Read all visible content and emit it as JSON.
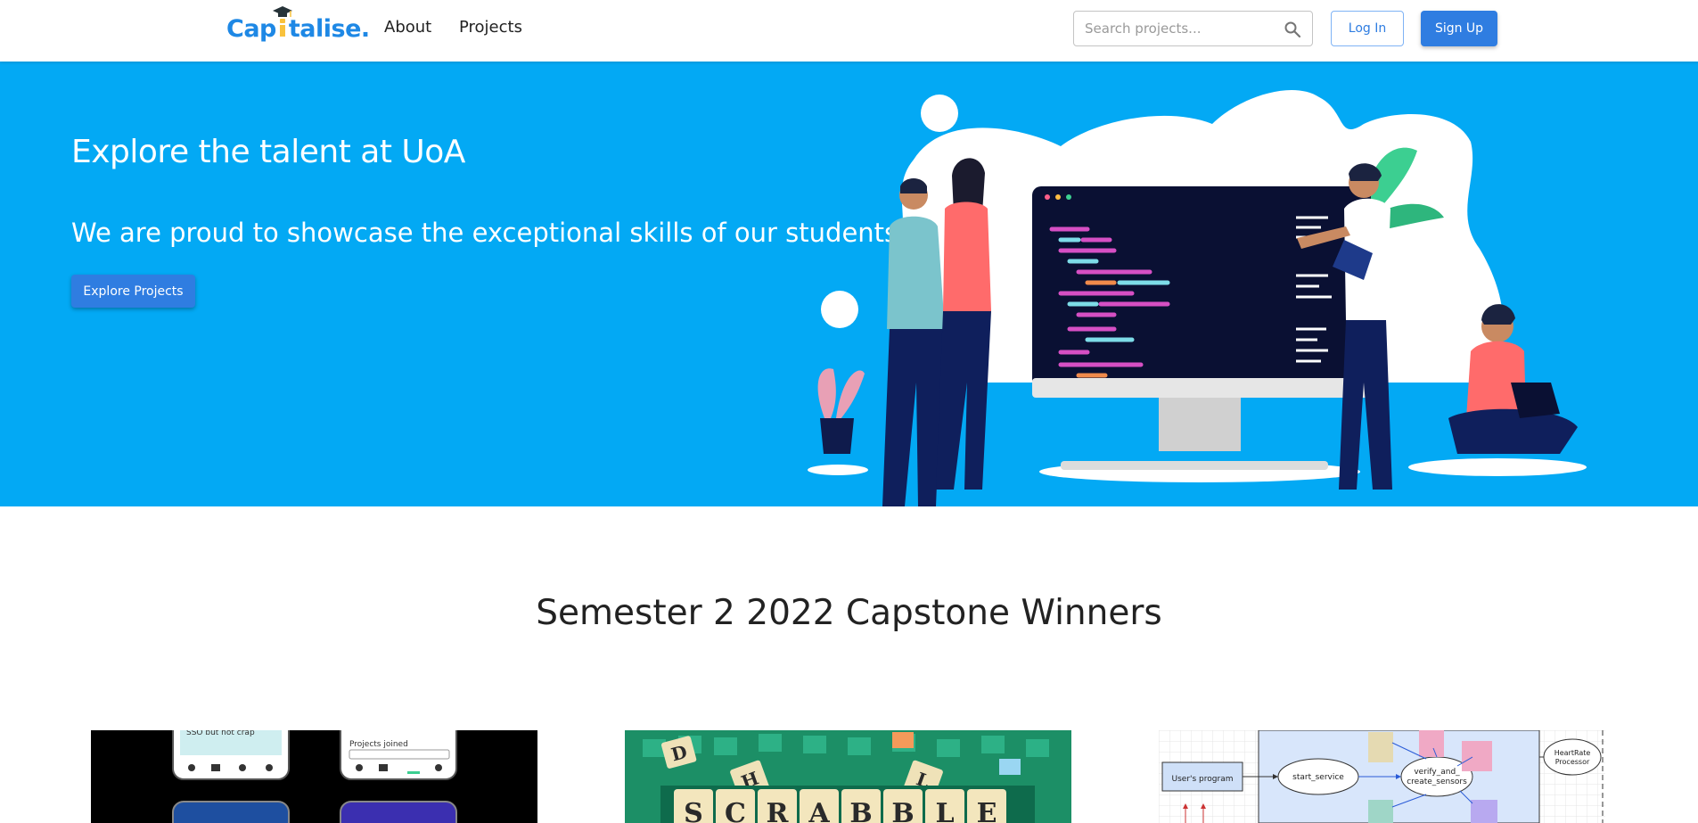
{
  "nav": {
    "logo_text_a": "Cap",
    "logo_text_b": "talise",
    "logo_dot": ".",
    "links": [
      {
        "label": "About"
      },
      {
        "label": "Projects"
      }
    ],
    "search_placeholder": "Search projects...",
    "login_label": "Log In",
    "signup_label": "Sign Up"
  },
  "hero": {
    "title": "Explore the talent at UoA",
    "subtitle": "We are proud to showcase the exceptional skills of our students.",
    "cta_label": "Explore Projects",
    "background_color": "#03a9f4"
  },
  "section": {
    "title": "Semester 2 2022 Capstone Winners"
  },
  "cards": [
    {
      "image": "mobile-app-screens",
      "visible_text": [
        "SSO but not crap",
        "Projects joined"
      ]
    },
    {
      "image": "scrabble-board",
      "visible_text": [
        "S",
        "C",
        "R",
        "A",
        "B",
        "B",
        "L",
        "E",
        "D",
        "H",
        "L"
      ]
    },
    {
      "image": "architecture-diagram",
      "visible_text": [
        "User's program",
        "start_service",
        "verify_and_",
        "create_sensors",
        "HeartRate",
        "Processor"
      ]
    }
  ],
  "colors": {
    "brand_blue": "#2f7de1",
    "hero_blue": "#03a9f4",
    "logo_blue": "#1e88e5"
  }
}
